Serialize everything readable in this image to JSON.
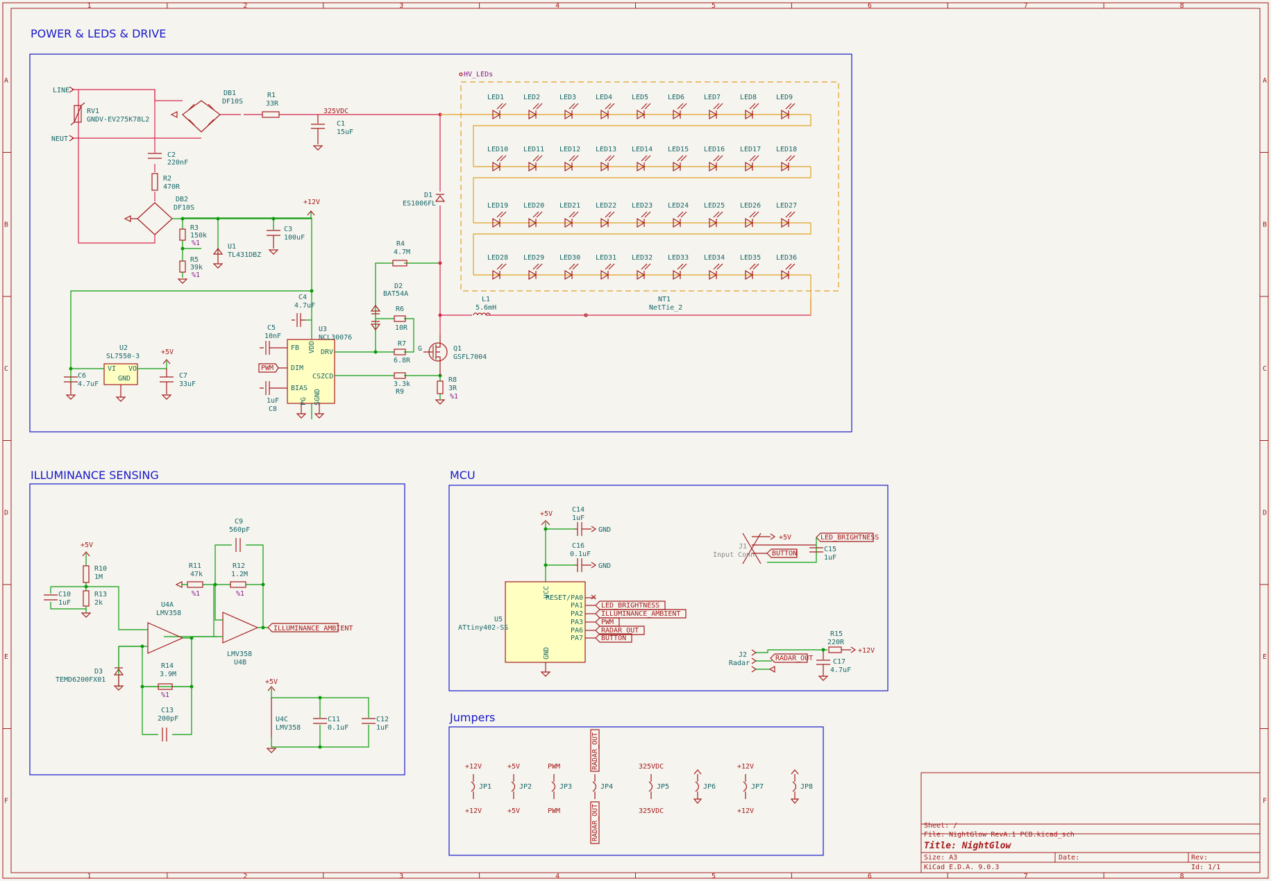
{
  "border": {
    "columns": [
      "1",
      "2",
      "3",
      "4",
      "5",
      "6",
      "7",
      "8"
    ],
    "rows": [
      "A",
      "B",
      "C",
      "D",
      "E",
      "F"
    ]
  },
  "blocks": {
    "power": "POWER & LEDS & DRIVE",
    "illum": "ILLUMINANCE SENSING",
    "mcu": "MCU",
    "jumpers": "Jumpers"
  },
  "power": {
    "line": "LINE",
    "neut": "NEUT",
    "rv1_ref": "RV1",
    "rv1_val": "GNDV-EV275K78L2",
    "db1_ref": "DB1",
    "db1_val": "DF10S",
    "r1_ref": "R1",
    "r1_val": "33R",
    "hv_label": "325VDC",
    "c1_ref": "C1",
    "c1_val": "15uF",
    "c2_ref": "C2",
    "c2_val": "220nF",
    "r2_ref": "R2",
    "r2_val": "470R",
    "db2_ref": "DB2",
    "db2_val": "DF10S",
    "r3_ref": "R3",
    "r3_val": "150k",
    "r3_tol": "%1",
    "r5_ref": "R5",
    "r5_val": "39k",
    "r5_tol": "%1",
    "u1_ref": "U1",
    "u1_val": "TL431DBZ",
    "c3_ref": "C3",
    "c3_val": "100uF",
    "p12v": "+12V",
    "c4_ref": "C4",
    "c4_val": "4.7uF",
    "u2_ref": "U2",
    "u2_val": "SL7550-3",
    "u2_vi": "VI",
    "u2_vo": "VO",
    "u2_gnd": "GND",
    "p5v": "+5V",
    "c6_ref": "C6",
    "c6_val": "4.7uF",
    "c7_ref": "C7",
    "c7_val": "33uF",
    "c5_ref": "C5",
    "c5_val": "10nF",
    "c8_ref": "C8",
    "c8_val": "1uF",
    "u3_ref": "U3",
    "u3_val": "NCL30076",
    "u3_pins": [
      "FB",
      "DIM",
      "BIAS",
      "VDD",
      "DRV",
      "CSZCD",
      "PG",
      "SGND"
    ],
    "pwm": "PWM",
    "d1_ref": "D1",
    "d1_val": "ES1006FL",
    "r4_ref": "R4",
    "r4_val": "4.7M",
    "d2_ref": "D2",
    "d2_val": "BAT54A",
    "r6_ref": "R6",
    "r6_val": "10R",
    "r7_ref": "R7",
    "r7_val": "6.8R",
    "r9_val": "3.3k",
    "r9_ref": "R9",
    "q1_ref": "Q1",
    "q1_val": "GSFL7004",
    "g": "G",
    "r8_ref": "R8",
    "r8_val": "3R",
    "r8_tol": "%1",
    "l1_ref": "L1",
    "l1_val": "5.6mH",
    "nt1_ref": "NT1",
    "nt1_val": "NetTie_2",
    "hv_leds": "HV_LEDs",
    "leds": [
      [
        "LED1",
        "LED2",
        "LED3",
        "LED4",
        "LED5",
        "LED6",
        "LED7",
        "LED8",
        "LED9"
      ],
      [
        "LED10",
        "LED11",
        "LED12",
        "LED13",
        "LED14",
        "LED15",
        "LED16",
        "LED17",
        "LED18"
      ],
      [
        "LED19",
        "LED20",
        "LED21",
        "LED22",
        "LED23",
        "LED24",
        "LED25",
        "LED26",
        "LED27"
      ],
      [
        "LED28",
        "LED29",
        "LED30",
        "LED31",
        "LED32",
        "LED33",
        "LED34",
        "LED35",
        "LED36"
      ]
    ]
  },
  "illum": {
    "p5v": "+5V",
    "r10_ref": "R10",
    "r10_val": "1M",
    "r13_ref": "R13",
    "r13_val": "2k",
    "c10_ref": "C10",
    "c10_val": "1uF",
    "u4a_ref": "U4A",
    "u4a_val": "LMV358",
    "d3_ref": "D3",
    "d3_val": "TEMD6200FX01",
    "r11_ref": "R11",
    "r11_val": "47k",
    "r11_tol": "%1",
    "r12_ref": "R12",
    "r12_val": "1.2M",
    "r12_tol": "%1",
    "c9_ref": "C9",
    "c9_val": "560pF",
    "r14_ref": "R14",
    "r14_val": "3.9M",
    "r14_tol": "%1",
    "c13_ref": "C13",
    "c13_val": "200pF",
    "u4b_ref": "U4B",
    "u4b_val": "LMV358",
    "ill_amb": "ILLUMINANCE_AMBIENT",
    "u4c_ref": "U4C",
    "u4c_val": "LMV358",
    "c11_ref": "C11",
    "c11_val": "0.1uF",
    "c12_ref": "C12",
    "c12_val": "1uF"
  },
  "mcu": {
    "p5v": "+5V",
    "c14_ref": "C14",
    "c14_val": "1uF",
    "c16_ref": "C16",
    "c16_val": "0.1uF",
    "gnd": "GND",
    "u5_ref": "U5",
    "u5_val": "ATtiny402-SS",
    "vcc": "VCC",
    "gnd_pin": "GND",
    "pins": [
      "RESET/PA0",
      "PA1",
      "PA2",
      "PA3",
      "PA6",
      "PA7"
    ],
    "nets": [
      "LED_BRIGHTNESS",
      "ILLUMINANCE_AMBIENT",
      "PWM",
      "RADAR_OUT",
      "BUTTON"
    ],
    "j1_ref": "J1",
    "j1_val": "Input Conn",
    "j1_p5v": "+5V",
    "j1_led": "LED_BRIGHTNESS",
    "j1_btn": "BUTTON",
    "c15_ref": "C15",
    "c15_val": "1uF",
    "j2_ref": "J2",
    "j2_val": "Radar",
    "j2_net": "RADAR_OUT",
    "r15_ref": "R15",
    "r15_val": "220R",
    "r15_p12": "+12V",
    "c17_ref": "C17",
    "c17_val": "4.7uF"
  },
  "jumpers": {
    "items": [
      {
        "ref": "JP1",
        "top": "+12V",
        "bottom": "+12V"
      },
      {
        "ref": "JP2",
        "top": "+5V",
        "bottom": "+5V"
      },
      {
        "ref": "JP3",
        "top": "PWM",
        "bottom": "PWM"
      },
      {
        "ref": "JP4",
        "top": "RADAR_OUT",
        "bottom": "RADAR_OUT"
      },
      {
        "ref": "JP5",
        "top": "325VDC",
        "bottom": "325VDC"
      },
      {
        "ref": "JP6",
        "top": "",
        "bottom": ""
      },
      {
        "ref": "JP7",
        "top": "+12V",
        "bottom": "+12V"
      },
      {
        "ref": "JP8",
        "top": "",
        "bottom": ""
      }
    ]
  },
  "title_block": {
    "sheet": "Sheet: /",
    "file": "File: NightGlow RevA.1 PCB.kicad_sch",
    "title": "Title: NightGlow",
    "size": "Size: A3",
    "date": "Date:",
    "rev": "Rev:",
    "tool": "KiCad E.D.A. 9.0.3",
    "id": "Id: 1/1"
  }
}
